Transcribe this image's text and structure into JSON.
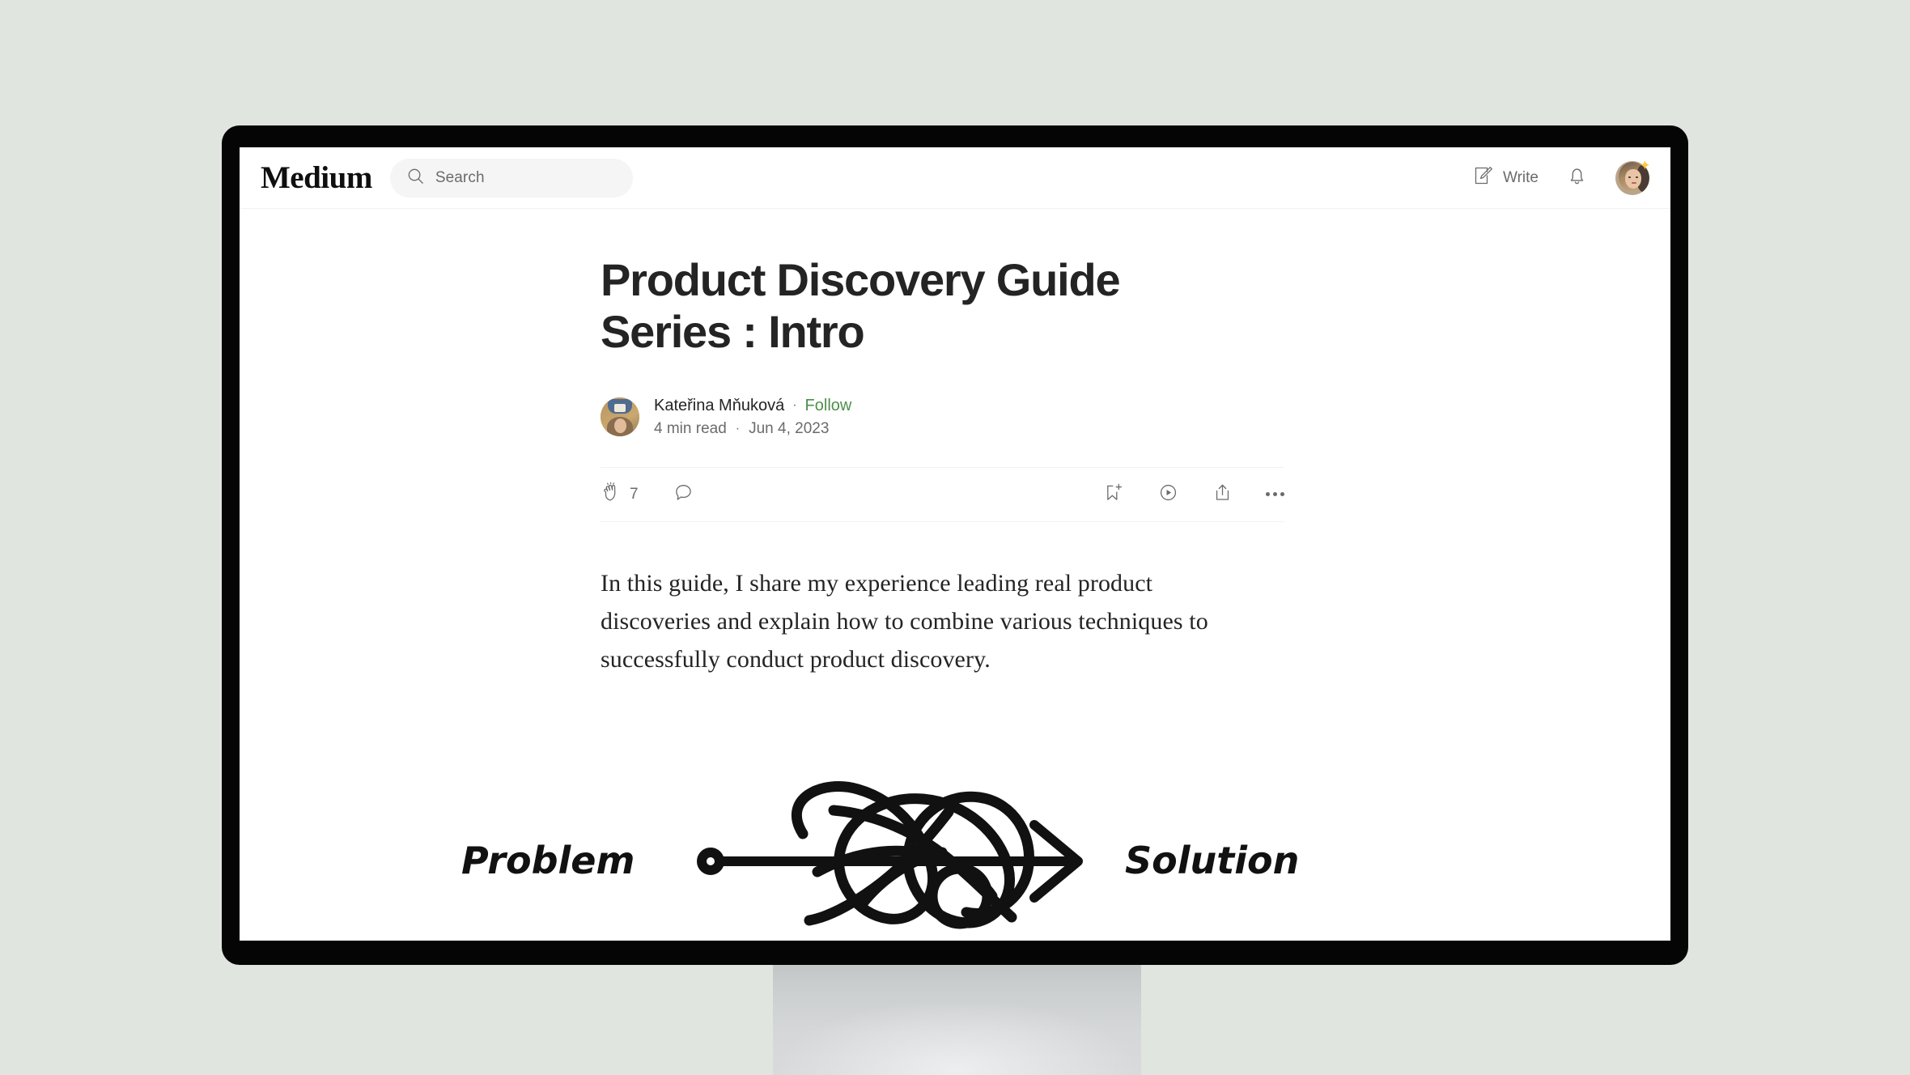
{
  "site": {
    "brand": "Medium",
    "search": {
      "placeholder": "Search",
      "value": "Search",
      "icon": "search-icon"
    },
    "write_label": "Write",
    "write_icon": "write-pencil-icon",
    "notifications_icon": "bell-icon",
    "avatar_badge_icon": "sparkle-star-icon"
  },
  "article": {
    "title": "Product Discovery Guide Series : Intro",
    "author": {
      "name": "Kateřina Mňuková",
      "follow_label": "Follow",
      "separator": "·"
    },
    "meta": {
      "read_time": "4 min read",
      "separator": "·",
      "date": "Jun 4, 2023"
    },
    "actions": {
      "clap_icon": "clap-icon",
      "clap_count": "7",
      "comment_icon": "comment-icon",
      "bookmark_icon": "bookmark-add-icon",
      "listen_icon": "play-listen-icon",
      "share_icon": "share-upload-icon",
      "more_icon": "more-horizontal-icon"
    },
    "body": "In this guide, I share my experience leading real product discoveries and explain how to combine various techniques to successfully conduct product discovery.",
    "figure": {
      "left_label": "Problem",
      "right_label": "Solution",
      "description": "tangled-scribble-arrow"
    }
  },
  "colors": {
    "page_background": "#e0e5df",
    "bezel": "#050505",
    "screen": "#ffffff",
    "text_primary": "#242424",
    "text_secondary": "#6b6b6b",
    "follow_green": "#4e8f4a",
    "search_field": "#f5f5f5",
    "badge_yellow": "#ffc83d",
    "stand_gray": "#d5d7d8"
  }
}
